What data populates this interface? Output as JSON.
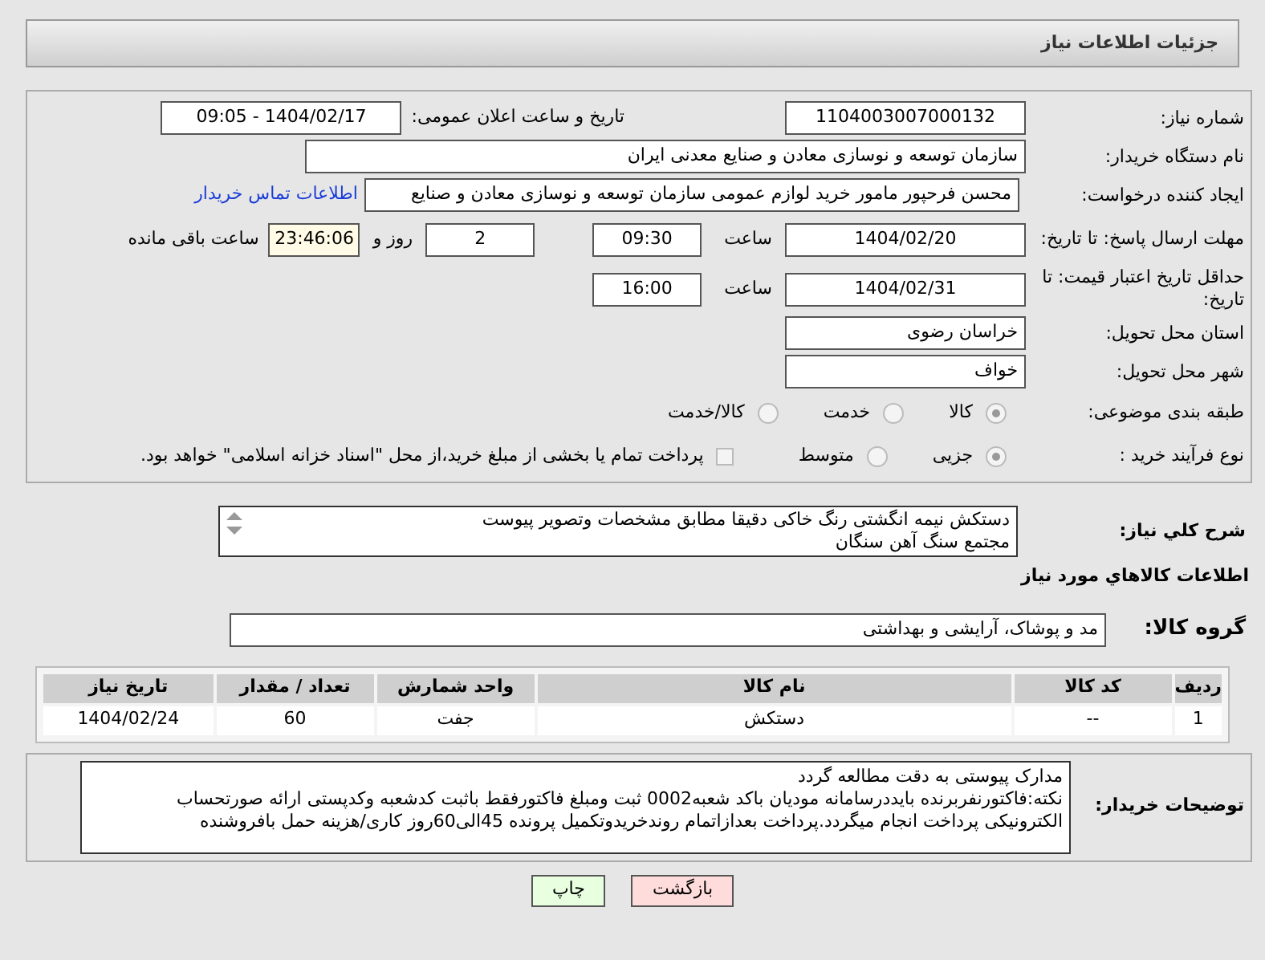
{
  "header": {
    "title": "جزئیات اطلاعات نیاز"
  },
  "need_number": {
    "label": "شماره نیاز:",
    "value": "1104003007000132"
  },
  "announce": {
    "label": "تاریخ و ساعت اعلان عمومی:",
    "value": "1404/02/17 - 09:05"
  },
  "buyer": {
    "label": "نام دستگاه خریدار:",
    "value": "سازمان توسعه و نوسازی معادن و صنایع معدنی ایران"
  },
  "requester": {
    "label": "ایجاد کننده درخواست:",
    "value": "محسن فرحپور مامور خرید لوازم عمومی سازمان توسعه و نوسازی معادن و صنایع",
    "link": "اطلاعات تماس خریدار"
  },
  "deadline": {
    "label": "مهلت ارسال پاسخ: تا تاریخ:",
    "date": "1404/02/20",
    "time_label": "ساعت",
    "time": "09:30",
    "days": "2",
    "days_label": "روز و",
    "remaining": "23:46:06",
    "remaining_label": "ساعت باقی مانده"
  },
  "validity": {
    "label": "حداقل تاریخ اعتبار قیمت: تا تاریخ:",
    "date": "1404/02/31",
    "time_label": "ساعت",
    "time": "16:00"
  },
  "province": {
    "label": "استان محل تحویل:",
    "value": "خراسان رضوی"
  },
  "city": {
    "label": "شهر محل تحویل:",
    "value": "خواف"
  },
  "category": {
    "label": "طبقه بندی موضوعی:",
    "options": [
      {
        "label": "کالا",
        "selected": true
      },
      {
        "label": "خدمت",
        "selected": false
      },
      {
        "label": "کالا/خدمت",
        "selected": false
      }
    ]
  },
  "process": {
    "label": "نوع فرآیند خرید :",
    "options": [
      {
        "label": "جزیی",
        "selected": true
      },
      {
        "label": "متوسط",
        "selected": false
      }
    ],
    "payment": {
      "checked": false,
      "label": "پرداخت تمام یا بخشی از مبلغ خرید،از محل \"اسناد خزانه اسلامی\" خواهد بود."
    }
  },
  "description": {
    "label": "شرح کلي نياز:",
    "lines": [
      "دستکش نیمه انگشتی رنگ خاکی دقیقا مطابق مشخصات وتصویر پیوست",
      "مجتمع سنگ آهن سنگان"
    ]
  },
  "goods_title": "اطلاعات کالاهاي مورد نياز",
  "goods_group": {
    "label": "گروه کالا:",
    "value": "مد و پوشاک، آرایشی و بهداشتی"
  },
  "table": {
    "columns": [
      "ردیف",
      "کد کالا",
      "نام کالا",
      "واحد شمارش",
      "تعداد / مقدار",
      "تاریخ نیاز"
    ],
    "rows": [
      [
        "1",
        "--",
        "دستکش",
        "جفت",
        "60",
        "1404/02/24"
      ]
    ]
  },
  "notes": {
    "label": "توضیحات خریدار:",
    "lines": [
      "مدارک پیوستی به دقت مطالعه گردد",
      "نکته:فاکتورنفربرنده بایددرسامانه مودیان باکد شعبه0002 ثبت ومبلغ فاکتورفقط باثبت کدشعبه وکدپستی ارائه صورتحساب",
      "الکترونیکی پرداخت انجام میگردد.پرداخت بعدازاتمام روندخریدوتکمیل پرونده 45الی60روز کاری/هزینه حمل بافروشنده"
    ]
  },
  "buttons": [
    {
      "kind": "back",
      "label": "بازگشت"
    },
    {
      "kind": "print",
      "label": "چاپ"
    }
  ]
}
